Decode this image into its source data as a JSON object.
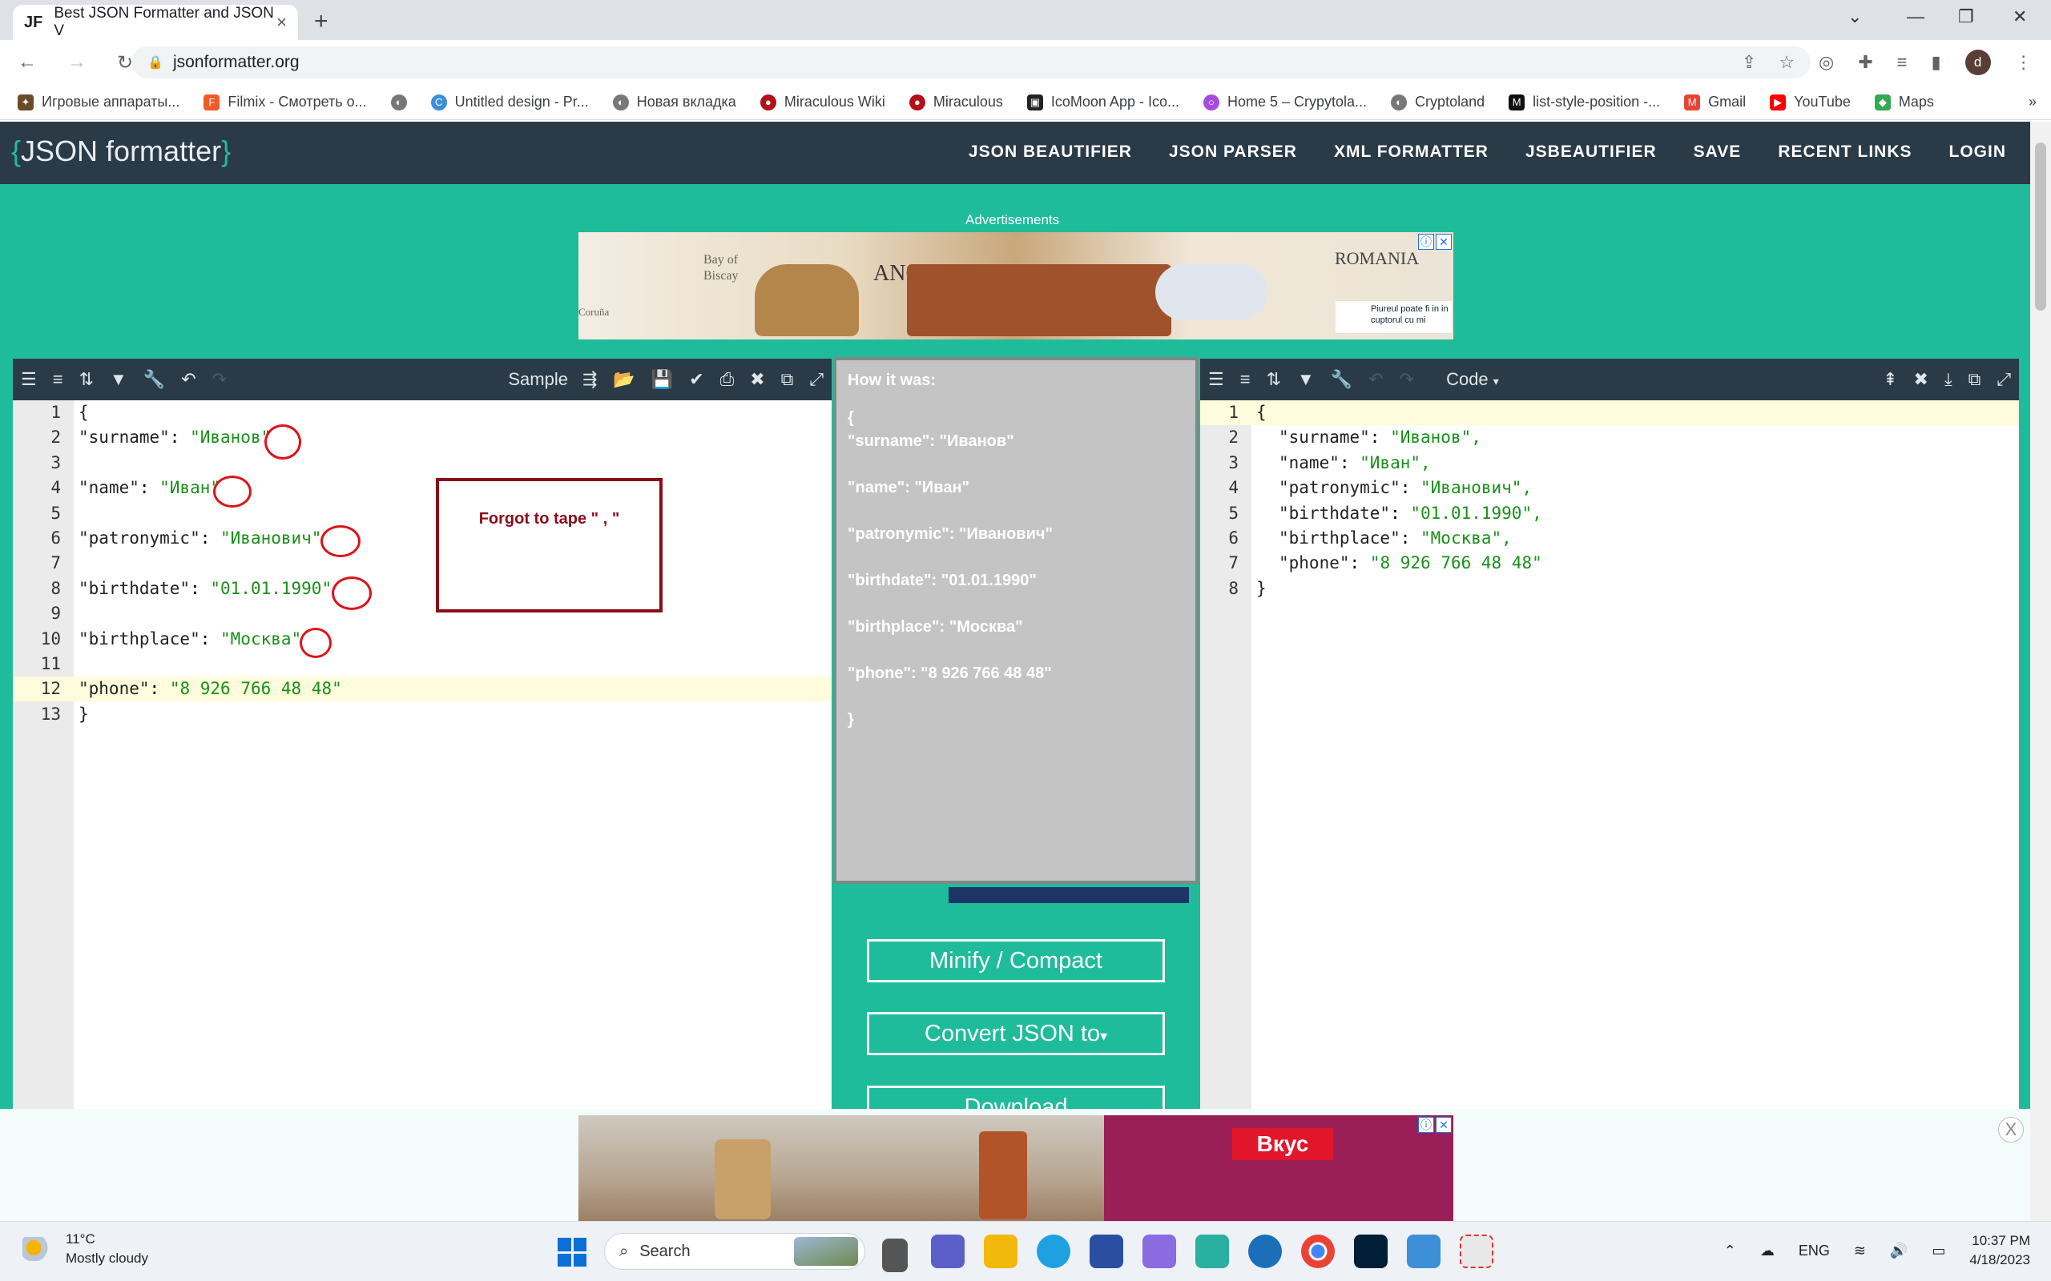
{
  "browser": {
    "tab_title": "Best JSON Formatter and JSON V",
    "tab_favicon": "JF",
    "url": "jsonformatter.org",
    "bookmarks": [
      "Игровые аппараты...",
      "Filmix - Смотреть о...",
      "",
      "Untitled design - Pr...",
      "Новая вкладка",
      "Miraculous Wiki",
      "Miraculous",
      "IcoMoon App - Ico...",
      "Home 5 – Crypytola...",
      "Cryptoland",
      "list-style-position -...",
      "Gmail",
      "YouTube",
      "Maps"
    ],
    "avatar_letter": "d"
  },
  "site": {
    "logo_brace_open": "{",
    "logo_text": "JSON formatter",
    "logo_brace_close": "}",
    "nav": [
      "JSON BEAUTIFIER",
      "JSON PARSER",
      "XML FORMATTER",
      "JSBEAUTIFIER",
      "SAVE",
      "RECENT LINKS",
      "LOGIN"
    ],
    "advertisements_label": "Advertisements"
  },
  "ad_top": {
    "text_bay": "Bay of",
    "text_biscay": "Biscay",
    "text_romania": "ROMANIA",
    "text_ance": "ANCE",
    "text_info": "Piureul poate fi in in cuptorul cu mi",
    "text_corogna": "Coruña"
  },
  "left_panel": {
    "sample_label": "Sample",
    "lines": [
      {
        "n": "1",
        "key": "",
        "val": "{"
      },
      {
        "n": "2",
        "key": "\"surname\"",
        "val": "\"Иванов\""
      },
      {
        "n": "3",
        "key": "",
        "val": ""
      },
      {
        "n": "4",
        "key": "\"name\"",
        "val": "\"Иван\""
      },
      {
        "n": "5",
        "key": "",
        "val": ""
      },
      {
        "n": "6",
        "key": "\"patronymic\"",
        "val": "\"Иванович\""
      },
      {
        "n": "7",
        "key": "",
        "val": ""
      },
      {
        "n": "8",
        "key": "\"birthdate\"",
        "val": "\"01.01.1990\""
      },
      {
        "n": "9",
        "key": "",
        "val": ""
      },
      {
        "n": "10",
        "key": "\"birthplace\"",
        "val": "\"Москва\""
      },
      {
        "n": "11",
        "key": "",
        "val": ""
      },
      {
        "n": "12",
        "key": "\"phone\"",
        "val": "\"8 926 766 48 48\""
      },
      {
        "n": "13",
        "key": "",
        "val": "}"
      }
    ],
    "note": "Forgot to tape \" , \""
  },
  "middle_panel": {
    "title": "How it was:",
    "lines": [
      "{",
      "\"surname\": \"Иванов\"",
      "",
      "\"name\": \"Иван\"",
      "",
      "\"patronymic\": \"Иванович\"",
      "",
      "\"birthdate\": \"01.01.1990\"",
      "",
      "\"birthplace\": \"Москва\"",
      "",
      "\"phone\": \"8 926 766 48 48\"",
      "",
      "}"
    ],
    "buttons": [
      "Minify / Compact",
      "Convert JSON to",
      "Download"
    ]
  },
  "right_panel": {
    "mode_label": "Code",
    "lines": [
      {
        "n": "1",
        "key": "",
        "val": "{"
      },
      {
        "n": "2",
        "key": "\"surname\"",
        "val": "\"Иванов\","
      },
      {
        "n": "3",
        "key": "\"name\"",
        "val": "\"Иван\","
      },
      {
        "n": "4",
        "key": "\"patronymic\"",
        "val": "\"Иванович\","
      },
      {
        "n": "5",
        "key": "\"birthdate\"",
        "val": "\"01.01.1990\","
      },
      {
        "n": "6",
        "key": "\"birthplace\"",
        "val": "\"Москва\","
      },
      {
        "n": "7",
        "key": "\"phone\"",
        "val": "\"8 926 766 48 48\""
      },
      {
        "n": "8",
        "key": "",
        "val": "}"
      }
    ]
  },
  "ad_bottom": {
    "vkus": "Вкус"
  },
  "taskbar": {
    "temperature": "11°C",
    "weather": "Mostly cloudy",
    "search_placeholder": "Search",
    "lang": "ENG",
    "time": "10:37 PM",
    "date": "4/18/2023"
  },
  "colors": {
    "accent": "#1fbc9c",
    "header": "#2a3a46",
    "string": "#1a8f1a",
    "annotation": "#e0121a",
    "note": "#8b0d18"
  }
}
